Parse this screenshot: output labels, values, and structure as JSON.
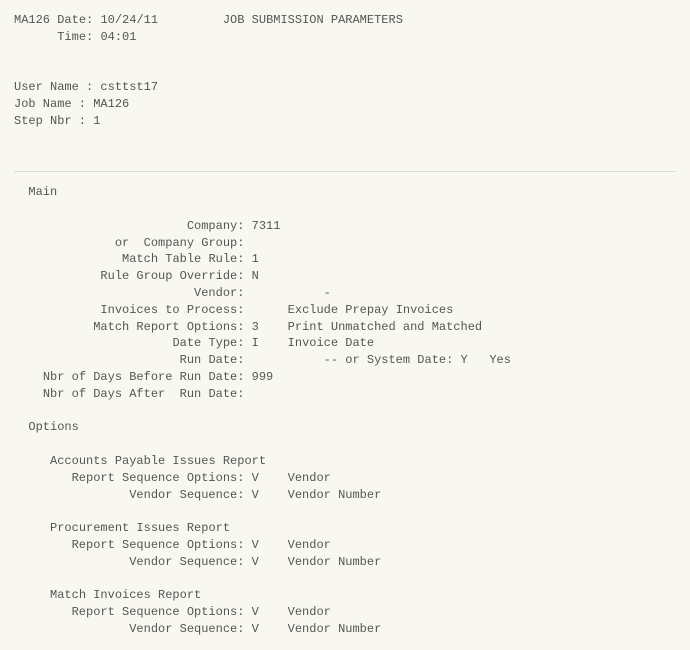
{
  "header": {
    "program_id": "MA126",
    "date_label": "Date:",
    "date": "10/24/11",
    "title": "JOB SUBMISSION PARAMETERS",
    "time_label": "Time:",
    "time": "04:01"
  },
  "user": {
    "user_name_label": "User Name :",
    "user_name": "csttst17",
    "job_name_label": "Job Name :",
    "job_name": "MA126",
    "step_nbr_label": "Step Nbr :",
    "step_nbr": "1"
  },
  "main": {
    "section_label": "Main",
    "company_label": "Company:",
    "company": "7311",
    "company_group_label": "or  Company Group:",
    "company_group": "",
    "match_table_rule_label": "Match Table Rule:",
    "match_table_rule": "1",
    "rule_group_override_label": "Rule Group Override:",
    "rule_group_override": "N",
    "vendor_label": "Vendor:",
    "vendor": "-",
    "invoices_to_process_label": "Invoices to Process:",
    "invoices_to_process_desc": "Exclude Prepay Invoices",
    "match_report_options_label": "Match Report Options:",
    "match_report_options_val": "3",
    "match_report_options_desc": "Print Unmatched and Matched",
    "date_type_label": "Date Type:",
    "date_type_val": "I",
    "date_type_desc": "Invoice Date",
    "run_date_label": "Run Date:",
    "run_date_sep": "-- or System Date:",
    "system_date_val": "Y",
    "system_date_desc": "Yes",
    "nbr_days_before_label": "Nbr of Days Before Run Date:",
    "nbr_days_before": "999",
    "nbr_days_after_label": "Nbr of Days After  Run Date:",
    "nbr_days_after": ""
  },
  "options": {
    "section_label": "Options",
    "ap_issues_report_label": "Accounts Payable Issues Report",
    "proc_issues_report_label": "Procurement Issues Report",
    "match_invoices_report_label": "Match Invoices Report",
    "report_seq_label": "Report Sequence Options:",
    "report_seq_val": "V",
    "report_seq_desc": "Vendor",
    "vendor_seq_label": "Vendor Sequence:",
    "vendor_seq_val": "V",
    "vendor_seq_desc": "Vendor Number"
  }
}
